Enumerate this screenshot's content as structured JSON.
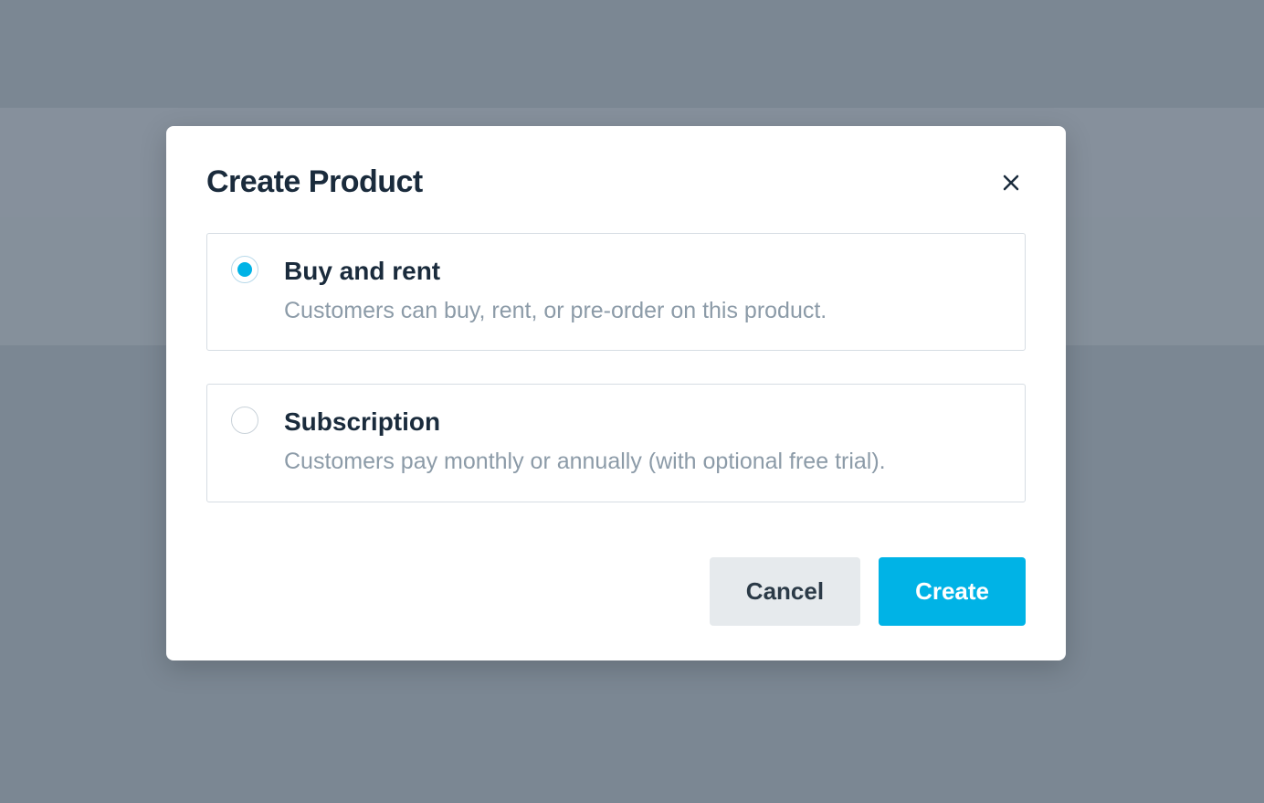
{
  "modal": {
    "title": "Create Product",
    "options": [
      {
        "title": "Buy and rent",
        "description": "Customers can buy, rent, or pre-order on this product.",
        "selected": true
      },
      {
        "title": "Subscription",
        "description": "Customers pay monthly or annually (with optional free trial).",
        "selected": false
      }
    ],
    "buttons": {
      "cancel": "Cancel",
      "create": "Create"
    }
  },
  "colors": {
    "accent": "#00b3e6"
  }
}
